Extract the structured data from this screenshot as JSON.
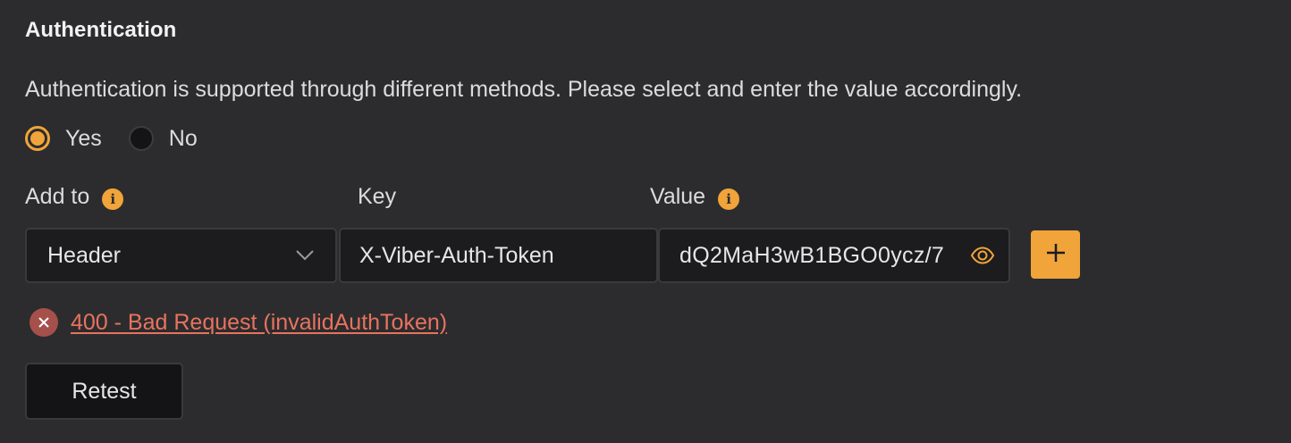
{
  "section": {
    "title": "Authentication",
    "description": "Authentication is supported through different methods. Please select and enter the value accordingly."
  },
  "auth_toggle": {
    "options": [
      {
        "label": "Yes",
        "checked": true
      },
      {
        "label": "No",
        "checked": false
      }
    ]
  },
  "fields": {
    "add_to_label": "Add to",
    "add_to_info_icon": "info-icon",
    "key_label": "Key",
    "value_label": "Value",
    "value_info_icon": "info-icon"
  },
  "inputs": {
    "add_to_selected": "Header",
    "key_value": "X-Viber-Auth-Token",
    "value_value": "dQ2MaH3wB1BGO0ycz/7"
  },
  "icons": {
    "dropdown": "chevron-down-icon",
    "reveal": "eye-icon",
    "add": "plus-icon",
    "error": "close-icon"
  },
  "status": {
    "error_text": "400 - Bad Request (invalidAuthToken)"
  },
  "actions": {
    "retest_label": "Retest"
  },
  "colors": {
    "background": "#2c2c2e",
    "accent": "#f0a43a",
    "error": "#e8735f",
    "error_icon_bg": "#a5504a",
    "input_bg": "#1c1c1e"
  }
}
